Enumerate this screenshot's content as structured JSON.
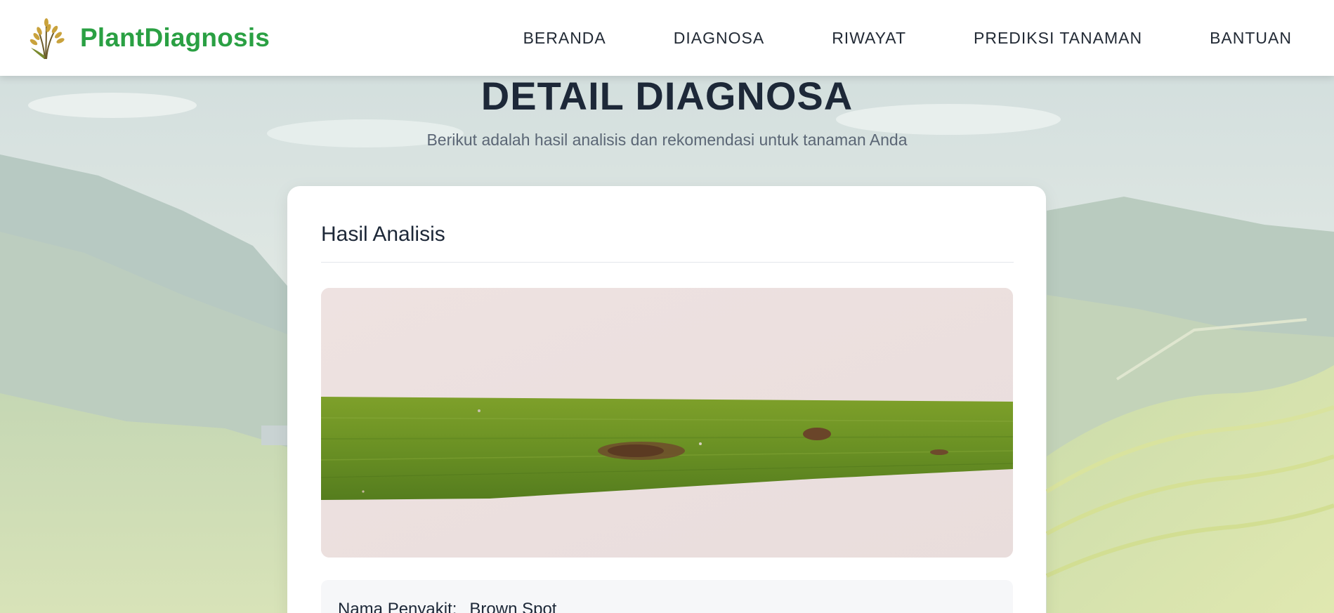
{
  "brand": {
    "name": "PlantDiagnosis",
    "logo_icon": "rice-plant-icon"
  },
  "nav": {
    "items": [
      {
        "label": "BERANDA"
      },
      {
        "label": "DIAGNOSA"
      },
      {
        "label": "RIWAYAT"
      },
      {
        "label": "PREDIKSI TANAMAN"
      },
      {
        "label": "BANTUAN"
      }
    ]
  },
  "page": {
    "title": "DETAIL DIAGNOSA",
    "subtitle": "Berikut adalah hasil analisis dan rekomendasi untuk tanaman Anda"
  },
  "card": {
    "title": "Hasil Analisis",
    "disease_label": "Nama Penyakit:",
    "disease_value": "Brown Spot"
  },
  "colors": {
    "brand_green": "#2aa043",
    "heading": "#1d2838",
    "muted": "#5b6675"
  }
}
